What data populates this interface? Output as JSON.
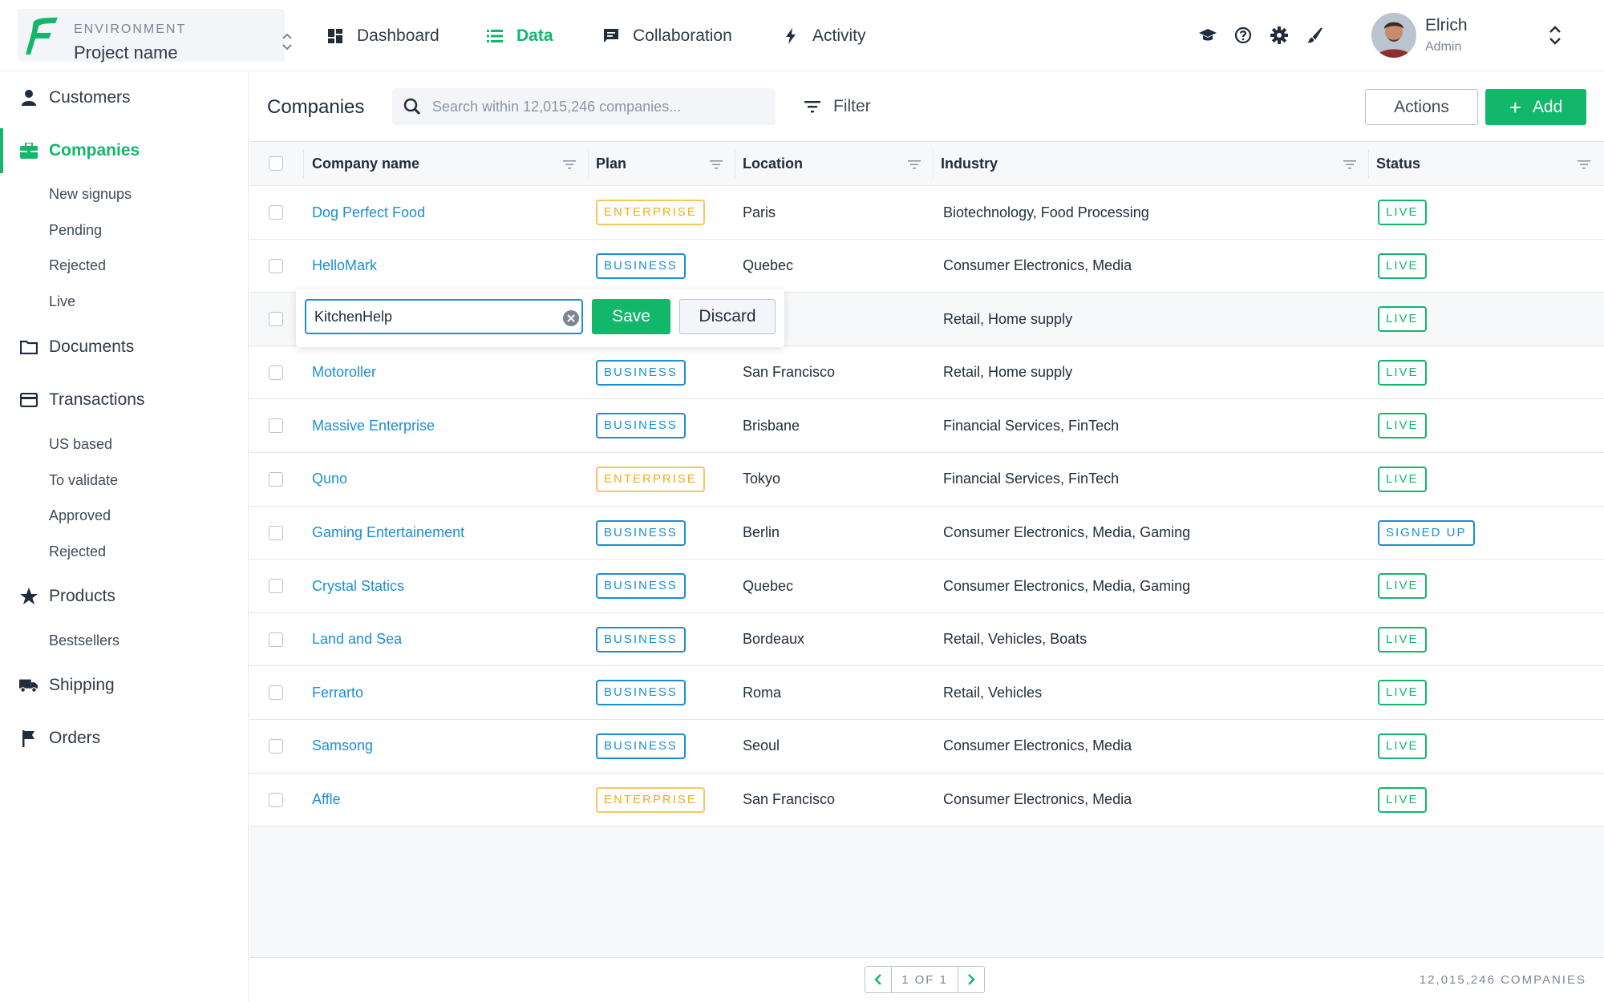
{
  "environment": {
    "label": "ENVIRONMENT",
    "project": "Project name"
  },
  "nav": [
    {
      "label": "Dashboard",
      "icon": "dashboard-icon"
    },
    {
      "label": "Data",
      "icon": "list-icon",
      "active": true
    },
    {
      "label": "Collaboration",
      "icon": "chat-icon"
    },
    {
      "label": "Activity",
      "icon": "bolt-icon"
    }
  ],
  "tools": [
    "graduation-cap-icon",
    "help-icon",
    "gear-icon",
    "brush-icon"
  ],
  "user": {
    "name": "Elrich",
    "role": "Admin"
  },
  "sidebar": {
    "items": [
      {
        "label": "Customers",
        "icon": "user-icon"
      },
      {
        "label": "Companies",
        "icon": "briefcase-icon",
        "active": true
      },
      {
        "label": "Documents",
        "icon": "folder-icon"
      },
      {
        "label": "Transactions",
        "icon": "credit-card-icon"
      },
      {
        "label": "Products",
        "icon": "star-icon"
      },
      {
        "label": "Shipping",
        "icon": "truck-icon"
      },
      {
        "label": "Orders",
        "icon": "flag-icon"
      }
    ],
    "companies_sub": [
      "New signups",
      "Pending",
      "Rejected",
      "Live"
    ],
    "transactions_sub": [
      "US based",
      "To validate",
      "Approved",
      "Rejected"
    ],
    "products_sub": [
      "Bestsellers"
    ]
  },
  "toolbar": {
    "title": "Companies",
    "search_placeholder": "Search within 12,015,246 companies...",
    "filter_label": "Filter",
    "actions_label": "Actions",
    "add_label": "Add"
  },
  "table": {
    "columns": [
      "Company name",
      "Plan",
      "Location",
      "Industry",
      "Status"
    ],
    "rows": [
      {
        "name": "Dog Perfect Food",
        "plan": "ENTERPRISE",
        "location": "Paris",
        "industry": "Biotechnology, Food Processing",
        "status": "LIVE"
      },
      {
        "name": "HelloMark",
        "plan": "BUSINESS",
        "location": "Quebec",
        "industry": "Consumer Electronics, Media",
        "status": "LIVE"
      },
      {
        "name": "",
        "plan": "",
        "location": "",
        "industry": "Retail, Home supply",
        "status": "LIVE",
        "editing": true
      },
      {
        "name": "Motoroller",
        "plan": "BUSINESS",
        "location": "San Francisco",
        "industry": "Retail, Home supply",
        "status": "LIVE"
      },
      {
        "name": "Massive Enterprise",
        "plan": "BUSINESS",
        "location": "Brisbane",
        "industry": "Financial Services, FinTech",
        "status": "LIVE"
      },
      {
        "name": "Quno",
        "plan": "ENTERPRISE",
        "location": "Tokyo",
        "industry": "Financial Services, FinTech",
        "status": "LIVE"
      },
      {
        "name": "Gaming Entertainement",
        "plan": "BUSINESS",
        "location": "Berlin",
        "industry": "Consumer Electronics, Media, Gaming",
        "status": "SIGNED UP"
      },
      {
        "name": "Crystal Statics",
        "plan": "BUSINESS",
        "location": "Quebec",
        "industry": "Consumer Electronics, Media, Gaming",
        "status": "LIVE"
      },
      {
        "name": "Land and Sea",
        "plan": "BUSINESS",
        "location": "Bordeaux",
        "industry": "Retail, Vehicles, Boats",
        "status": "LIVE"
      },
      {
        "name": "Ferrarto",
        "plan": "BUSINESS",
        "location": "Roma",
        "industry": "Retail, Vehicles",
        "status": "LIVE"
      },
      {
        "name": "Samsong",
        "plan": "BUSINESS",
        "location": "Seoul",
        "industry": "Consumer Electronics, Media",
        "status": "LIVE"
      },
      {
        "name": "Affle",
        "plan": "ENTERPRISE",
        "location": "San Francisco",
        "industry": "Consumer Electronics, Media",
        "status": "LIVE"
      }
    ]
  },
  "editor": {
    "value": "KitchenHelp",
    "save_label": "Save",
    "discard_label": "Discard"
  },
  "footer": {
    "page": "1 OF 1",
    "count": "12,015,246 COMPANIES"
  },
  "colors": {
    "accent": "#12b76a",
    "link": "#1a8fd6",
    "enterprise": "#f0ad1a"
  }
}
